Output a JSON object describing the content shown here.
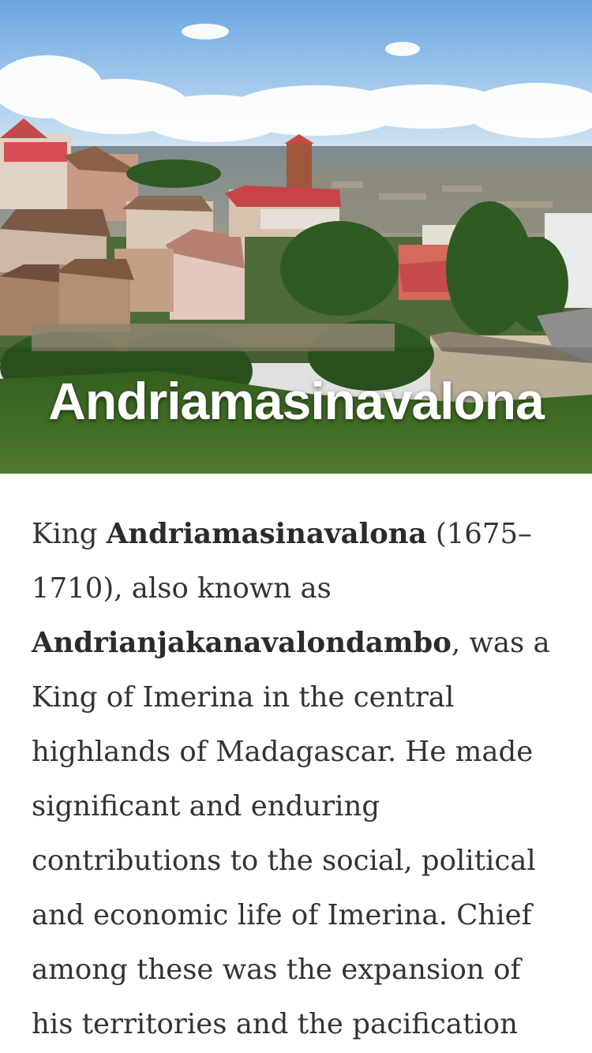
{
  "article": {
    "title": "Andriamasinavalona",
    "hero_image_alt": "Hillside view of Antananarivo with red-roofed houses and a brick tower",
    "intro": {
      "prefix": "King ",
      "bold_name": "Andriamasinavalona",
      "after_name": " (1675–1710), also known as ",
      "bold_alias": "Andrianjakanavalondambo",
      "rest": ", was a King of Imerina in the central highlands of Madagascar. He made significant and enduring contributions to the social, political and economic life of Imerina. Chief among these was the expansion of his territories and the pacification"
    }
  },
  "colors": {
    "title_text": "#ffffff",
    "body_text": "#333333",
    "background": "#ffffff"
  }
}
